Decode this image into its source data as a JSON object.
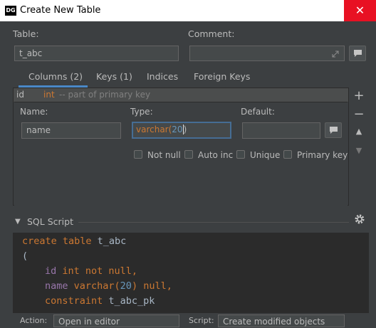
{
  "window": {
    "app_badge": "DG",
    "title": "Create New Table",
    "close_glyph": "✕"
  },
  "form": {
    "table_label": "Table:",
    "table_value": "t_abc",
    "comment_label": "Comment:",
    "comment_value": ""
  },
  "tabs": [
    {
      "label": "Columns (2)",
      "active": true
    },
    {
      "label": "Keys (1)",
      "active": false
    },
    {
      "label": "Indices",
      "active": false
    },
    {
      "label": "Foreign Keys",
      "active": false
    }
  ],
  "column_list": {
    "selected_row": {
      "name": "id",
      "type": "int",
      "note": "-- part of primary key"
    }
  },
  "column_editor": {
    "name_label": "Name:",
    "name_value": "name",
    "type_label": "Type:",
    "type_prefix": "varchar(",
    "type_number": "20",
    "type_suffix": ")",
    "default_label": "Default:",
    "default_value": "",
    "checkboxes": [
      {
        "label": "Not null",
        "checked": false
      },
      {
        "label": "Auto inc",
        "checked": false
      },
      {
        "label": "Unique",
        "checked": false
      },
      {
        "label": "Primary key",
        "checked": false
      }
    ]
  },
  "side_buttons": {
    "add": "+",
    "remove": "−",
    "up": "▲",
    "down": "▼"
  },
  "sql_section": {
    "title": "SQL Script",
    "lines": [
      [
        "create table",
        " t_abc"
      ],
      [
        "("
      ],
      [
        "id",
        " int not null,"
      ],
      [
        "name",
        " varchar(",
        "20",
        ") null,"
      ],
      [
        "constraint",
        " t_abc_pk"
      ]
    ]
  },
  "bottom": {
    "action_label": "Action:",
    "action_value": "Open in editor",
    "script_label": "Script:",
    "script_value": "Create modified objects"
  },
  "colors": {
    "accent": "#4a88c7",
    "keyword": "#cc7832",
    "column": "#9876aa",
    "number": "#6897bb",
    "close": "#e81123"
  }
}
